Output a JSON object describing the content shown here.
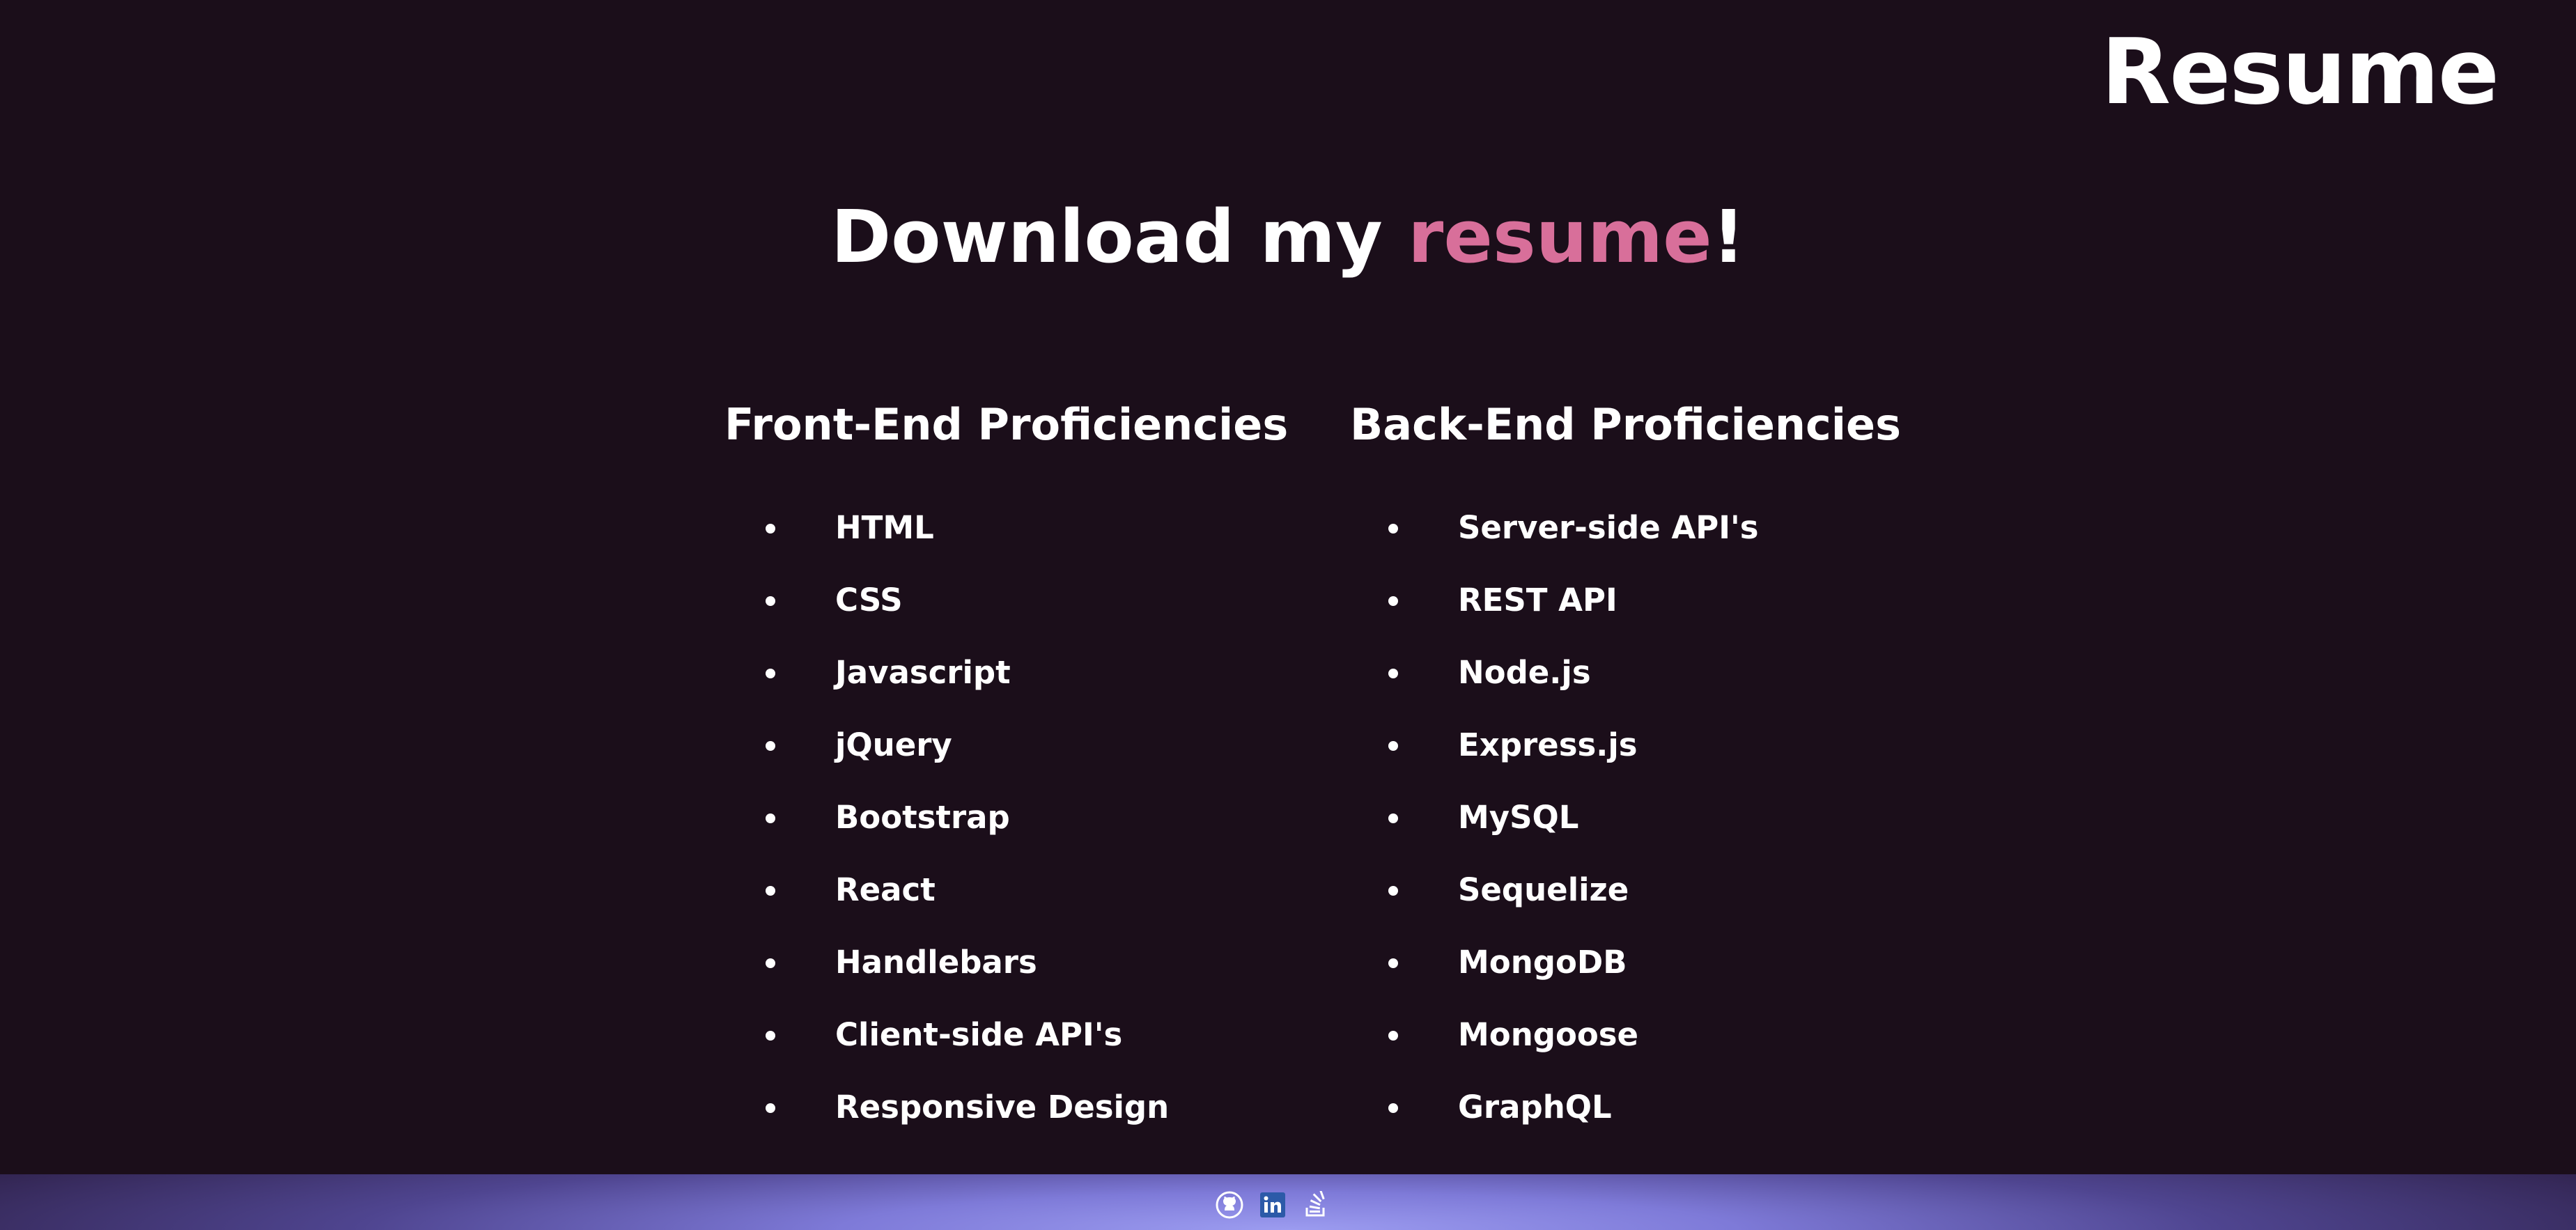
{
  "header": {
    "brand": "Resume"
  },
  "hero": {
    "prefix": "Download my ",
    "link": "resume",
    "suffix": "!"
  },
  "front_end": {
    "title": "Front-End Proficiencies",
    "items": [
      "HTML",
      "CSS",
      "Javascript",
      "jQuery",
      "Bootstrap",
      "React",
      "Handlebars",
      "Client-side API's",
      "Responsive Design"
    ]
  },
  "back_end": {
    "title": "Back-End Proficiencies",
    "items": [
      "Server-side API's",
      "REST API",
      "Node.js",
      "Express.js",
      "MySQL",
      "Sequelize",
      "MongoDB",
      "Mongoose",
      "GraphQL"
    ]
  },
  "footer": {
    "icons": [
      "github-icon",
      "linkedin-icon",
      "stackoverflow-icon"
    ]
  },
  "colors": {
    "background": "#1b0e1a",
    "accent": "#d86f9a",
    "footer_glow": "#9c9cf0"
  }
}
